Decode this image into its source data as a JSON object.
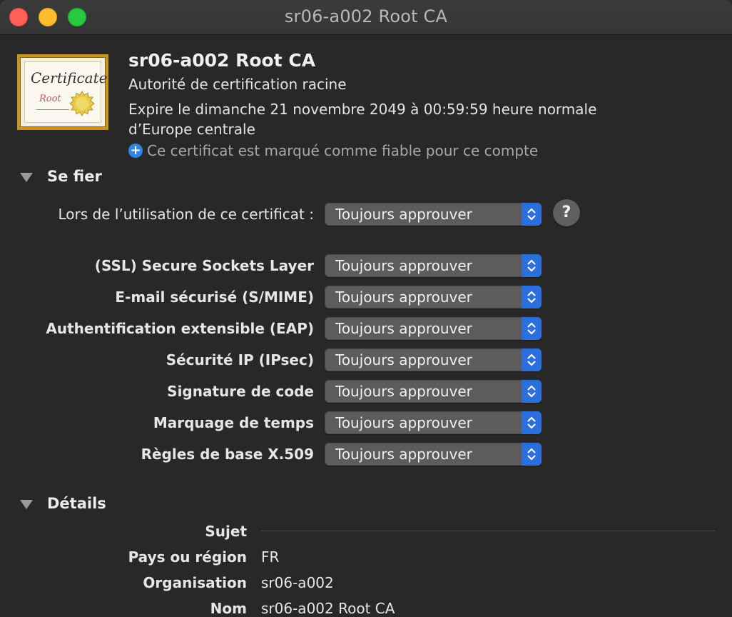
{
  "window": {
    "title": "sr06-a002 Root CA"
  },
  "certificate": {
    "icon_word": "Certificate",
    "icon_root": "Root",
    "name": "sr06-a002 Root CA",
    "kind": "Autorité de certification racine",
    "expires": "Expire le dimanche 21 novembre 2049 à 00:59:59 heure normale d’Europe centrale",
    "trust_status": "Ce certificat est marqué comme fiable pour ce compte"
  },
  "trust": {
    "section_label": "Se fier",
    "when_using_label": "Lors de l’utilisation de ce certificat :",
    "when_using_value": "Toujours approuver",
    "help_label": "?",
    "policies": [
      {
        "label": "(SSL) Secure Sockets Layer",
        "value": "Toujours approuver"
      },
      {
        "label": "E-mail sécurisé (S/MIME)",
        "value": "Toujours approuver"
      },
      {
        "label": "Authentification extensible (EAP)",
        "value": "Toujours approuver"
      },
      {
        "label": "Sécurité IP (IPsec)",
        "value": "Toujours approuver"
      },
      {
        "label": "Signature de code",
        "value": "Toujours approuver"
      },
      {
        "label": "Marquage de temps",
        "value": "Toujours approuver"
      },
      {
        "label": "Règles de base X.509",
        "value": "Toujours approuver"
      }
    ]
  },
  "details": {
    "section_label": "Détails",
    "subject_label": "Sujet",
    "rows": [
      {
        "label": "Pays ou région",
        "value": "FR"
      },
      {
        "label": "Organisation",
        "value": "sr06-a002"
      },
      {
        "label": "Nom",
        "value": "sr06-a002 Root CA"
      }
    ]
  },
  "colors": {
    "accent": "#2b6fdd",
    "background": "#282828",
    "gold": "#c9951f"
  }
}
